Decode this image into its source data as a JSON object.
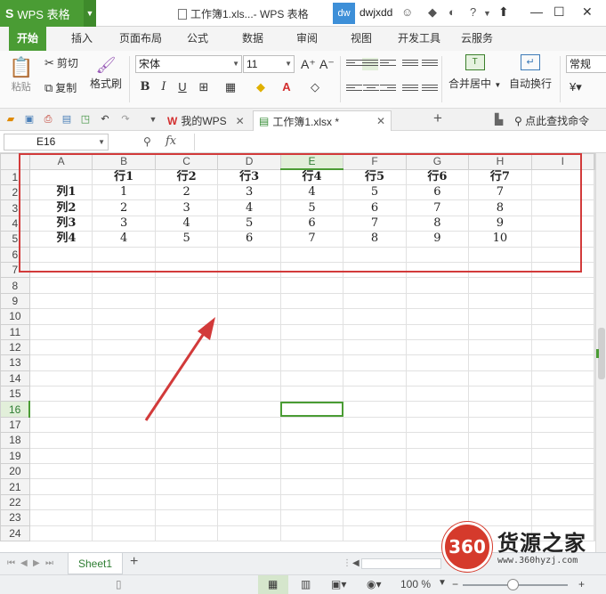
{
  "titlebar": {
    "app_name": "WPS 表格",
    "doc_title": "工作簿1.xls...- WPS 表格",
    "avatar_initials": "dw",
    "username": "dwjxdd"
  },
  "ribbon_tabs": [
    "开始",
    "插入",
    "页面布局",
    "公式",
    "数据",
    "审阅",
    "视图",
    "开发工具",
    "云服务"
  ],
  "ribbon": {
    "paste": "粘贴",
    "cut": "剪切",
    "copy": "复制",
    "format_painter": "格式刷",
    "font_name": "宋体",
    "font_size": "11",
    "bold": "B",
    "italic": "I",
    "underline": "U",
    "merge_center": "合并居中",
    "wrap_text": "自动换行",
    "number_format": "常规"
  },
  "doc_tabs": {
    "home_tab": "我的WPS",
    "file_tab": "工作簿1.xlsx *",
    "search_command": "点此查找命令"
  },
  "formula_bar": {
    "cell_ref": "E16",
    "fx": "fx",
    "formula": ""
  },
  "grid": {
    "columns": [
      "A",
      "B",
      "C",
      "D",
      "E",
      "F",
      "G",
      "H",
      "I"
    ],
    "selected_column": "E",
    "selected_row": 16,
    "row_count": 24,
    "header_row": [
      "",
      "行1",
      "行2",
      "行3",
      "行4",
      "行5",
      "行6",
      "行7",
      ""
    ],
    "data_rows": [
      [
        "列1",
        "1",
        "2",
        "3",
        "4",
        "5",
        "6",
        "7",
        ""
      ],
      [
        "列2",
        "2",
        "3",
        "4",
        "5",
        "6",
        "7",
        "8",
        ""
      ],
      [
        "列3",
        "3",
        "4",
        "5",
        "6",
        "7",
        "8",
        "9",
        ""
      ],
      [
        "列4",
        "4",
        "5",
        "6",
        "7",
        "8",
        "9",
        "10",
        ""
      ]
    ]
  },
  "sheets": {
    "active": "Sheet1"
  },
  "statusbar": {
    "zoom": "100 %"
  },
  "watermark": {
    "logo": "360",
    "brand": "货源之家",
    "url": "www.360hyzj.com"
  },
  "colors": {
    "accent": "#4a9c34",
    "highlight_box": "#d23a3a",
    "watermark_red": "#d53a2c"
  }
}
